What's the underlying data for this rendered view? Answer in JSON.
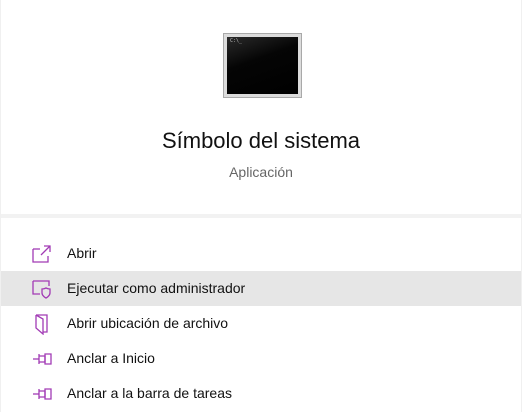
{
  "app": {
    "title": "Símbolo del sistema",
    "subtitle": "Aplicación",
    "icon": "command-prompt-icon",
    "prompt_text": "C:\\_"
  },
  "menu": {
    "items": [
      {
        "label": "Abrir",
        "icon": "open-external-icon"
      },
      {
        "label": "Ejecutar como administrador",
        "icon": "shield-admin-icon"
      },
      {
        "label": "Abrir ubicación de archivo",
        "icon": "file-location-icon"
      },
      {
        "label": "Anclar a Inicio",
        "icon": "pin-icon"
      },
      {
        "label": "Anclar a la barra de tareas",
        "icon": "pin-icon"
      }
    ],
    "highlighted_index": 1
  },
  "colors": {
    "accent": "#a23bb5",
    "hover": "#e6e6e6",
    "divider": "#f2f2f2"
  }
}
